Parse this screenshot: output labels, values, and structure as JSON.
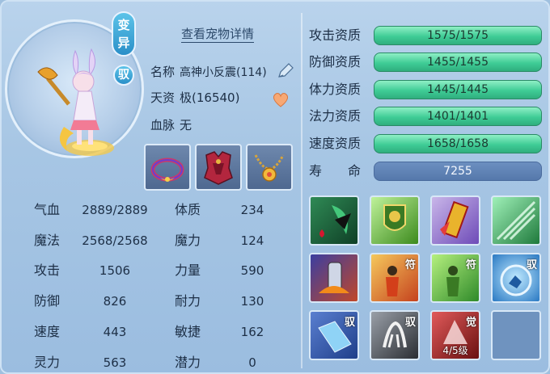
{
  "header": {
    "variant_badge": "变异",
    "tame_badge": "驭",
    "detail_link": "查看宠物详情"
  },
  "pet": {
    "name_label": "名称",
    "name_value": "高神小反震(114)",
    "talent_label": "天资",
    "talent_value": "极(16540)",
    "bloodline_label": "血脉",
    "bloodline_value": "无"
  },
  "equipment": [
    {
      "icon": "collar-icon"
    },
    {
      "icon": "armor-icon"
    },
    {
      "icon": "necklace-icon"
    }
  ],
  "stats_left": [
    {
      "label": "气血",
      "value": "2889/2889"
    },
    {
      "label": "魔法",
      "value": "2568/2568"
    },
    {
      "label": "攻击",
      "value": "1506"
    },
    {
      "label": "防御",
      "value": "826"
    },
    {
      "label": "速度",
      "value": "443"
    },
    {
      "label": "灵力",
      "value": "563"
    }
  ],
  "stats_right": [
    {
      "label": "体质",
      "value": "234"
    },
    {
      "label": "魔力",
      "value": "124"
    },
    {
      "label": "力量",
      "value": "590"
    },
    {
      "label": "耐力",
      "value": "130"
    },
    {
      "label": "敏捷",
      "value": "162"
    },
    {
      "label": "潜力",
      "value": "0"
    }
  ],
  "aptitudes": [
    {
      "label": "攻击资质",
      "value": "1575/1575"
    },
    {
      "label": "防御资质",
      "value": "1455/1455"
    },
    {
      "label": "体力资质",
      "value": "1445/1445"
    },
    {
      "label": "法力资质",
      "value": "1401/1401"
    },
    {
      "label": "速度资质",
      "value": "1658/1658"
    }
  ],
  "life": {
    "label": "寿　　命",
    "value": "7255"
  },
  "skills": [
    {
      "icon": "blood-drop-skill-icon",
      "tag": "",
      "level": ""
    },
    {
      "icon": "shield-skill-icon",
      "tag": "",
      "level": ""
    },
    {
      "icon": "talisman-skill-icon",
      "tag": "",
      "level": ""
    },
    {
      "icon": "wind-skill-icon",
      "tag": "",
      "level": ""
    },
    {
      "icon": "armor-skill-icon",
      "tag": "",
      "level": ""
    },
    {
      "icon": "fire-talisman-skill-icon",
      "tag": "符",
      "level": ""
    },
    {
      "icon": "green-talisman-skill-icon",
      "tag": "符",
      "level": ""
    },
    {
      "icon": "beast-skill-icon",
      "tag": "驭",
      "level": ""
    },
    {
      "icon": "crystal-skill-icon",
      "tag": "驭",
      "level": ""
    },
    {
      "icon": "claw-skill-icon",
      "tag": "驭",
      "level": ""
    },
    {
      "icon": "awaken-skill-icon",
      "tag": "觉",
      "level": "4/5级"
    },
    {
      "icon": "empty-slot",
      "tag": "",
      "level": ""
    }
  ]
}
